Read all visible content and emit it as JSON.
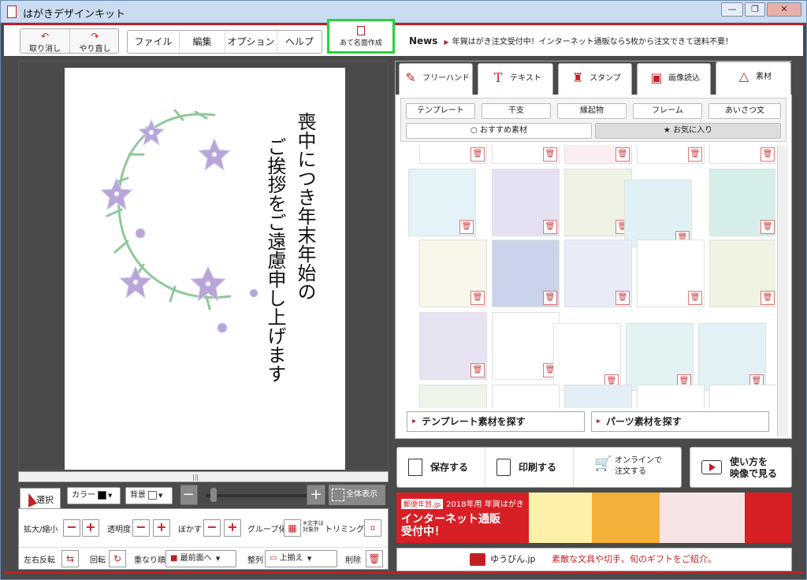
{
  "window": {
    "title": "はがきデザインキット",
    "min": "—",
    "max": "❐",
    "close": "✕"
  },
  "toolbar": {
    "undo_label": "取り消し",
    "redo_label": "やり直し",
    "menu": [
      "ファイル",
      "編集",
      "オプション",
      "ヘルプ"
    ],
    "address_label": "あて名面作成"
  },
  "news": {
    "label": "News",
    "text": "年賀はがき注文受付中！インターネット通販なら5枚から注文できて送料不要！"
  },
  "card": {
    "line1": "喪中につき年末年始の",
    "line2": "ご挨拶をご遠慮申し上げます"
  },
  "zoom": {
    "minus": "−",
    "plus": "+",
    "full_label": "全体表示",
    "level": 0.08
  },
  "tools": {
    "select": "選択",
    "color_label": "カラー",
    "color_value": "#000000",
    "bg_label": "背景",
    "bg_value": "#ffffff",
    "scale_label": "拡大/縮小",
    "opacity_label": "透明度",
    "blur_label": "ぼかす",
    "group_label": "グループ化",
    "group_note": "※文字は対象外",
    "trim_label": "トリミング",
    "flip_label": "左右反転",
    "rotate_label": "回転",
    "order_label": "重なり順",
    "order_value": "最前面へ",
    "align_label": "整列",
    "align_value": "上揃え",
    "delete_label": "削除"
  },
  "tabs": [
    "フリーハンド",
    "テキスト",
    "スタンプ",
    "画像読込",
    "素材"
  ],
  "subtabs": [
    "テンプレート",
    "干支",
    "縁起物",
    "フレーム",
    "あいさつ文"
  ],
  "subtabs2": [
    "おすすめ素材",
    "お気に入り"
  ],
  "find": {
    "template": "テンプレート素材を探す",
    "parts": "パーツ素材を探す"
  },
  "actions": {
    "save": "保存する",
    "print": "印刷する",
    "online": "オンラインで",
    "online2": "注文する",
    "video1": "使い方を",
    "video2": "映像で見る"
  },
  "banner": {
    "tag": "郵便年賀.jp",
    "small": "2018年用 年賀はがき",
    "big1": "インターネット通販",
    "big2": "受付中！"
  },
  "footer": {
    "site": "ゆうびん.jp",
    "text": "素敵な文具や切手、旬のギフトをご紹介。"
  },
  "colors": {
    "accent": "#c41e24",
    "highlight": "#29d33a"
  }
}
